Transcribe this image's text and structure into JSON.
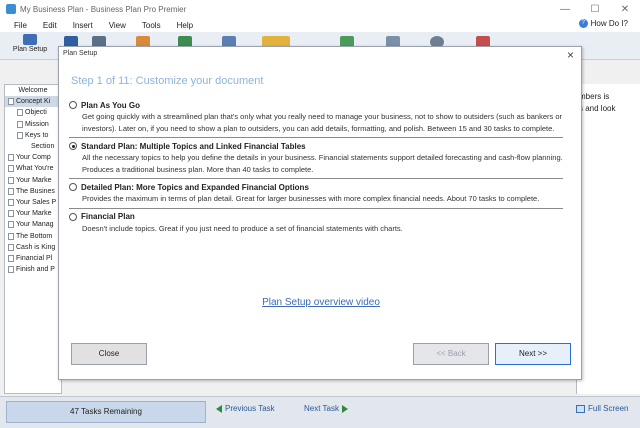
{
  "window": {
    "title": "My Business Plan - Business Plan Pro Premier",
    "minimize": "—",
    "maximize": "☐",
    "close": "✕"
  },
  "menu": {
    "items": [
      "File",
      "Edit",
      "Insert",
      "View",
      "Tools",
      "Help"
    ],
    "how_do_i": "How Do I?"
  },
  "toolbar": {
    "plan_setup": "Plan Setup"
  },
  "sidebar": {
    "items": [
      "Welcome",
      "Concept Ki",
      "Objecti",
      "Mission",
      "Keys to",
      "Section",
      "Your Comp",
      "What You're",
      "Your Marke",
      "The Busines",
      "Your Sales P",
      "Your Marke",
      "Your Manag",
      "The Bottom",
      "Cash is King",
      "Financial Pl",
      "Finish and P"
    ]
  },
  "right_panel": {
    "line1": "mbers is",
    "line2": "s and look"
  },
  "dialog": {
    "title": "Plan Setup",
    "close": "×",
    "step": "Step 1 of 11: Customize your document",
    "options": [
      {
        "title": "Plan As You Go",
        "desc": "Get going quickly with a streamlined plan that's only what you really need to manage your business, not to show to outsiders (such as bankers or investors). Later on, if you need to show a plan to outsiders, you can add details, formatting, and polish. Between 15 and 30 tasks to complete.",
        "checked": false
      },
      {
        "title": "Standard Plan: Multiple Topics and Linked Financial Tables",
        "desc": "All the necessary topics to help you define the details in your business. Financial statements support detailed forecasting and cash-flow planning. Produces a traditional business plan. More than 40 tasks to complete.",
        "checked": true
      },
      {
        "title": "Detailed Plan: More Topics and Expanded Financial Options",
        "desc": "Provides the maximum in terms of plan detail. Great for larger businesses with more complex financial needs. About 70 tasks to complete.",
        "checked": false
      },
      {
        "title": "Financial Plan",
        "desc": "Doesn't include topics. Great if you just need to produce a set of financial statements with charts.",
        "checked": false
      }
    ],
    "video_link": "Plan Setup overview video",
    "close_button": "Close",
    "back_button": "<< Back",
    "next_button": "Next >>"
  },
  "status": {
    "tasks_remaining": "47 Tasks Remaining",
    "previous_task": "Previous Task",
    "next_task": "Next Task",
    "full_screen": "Full Screen"
  }
}
